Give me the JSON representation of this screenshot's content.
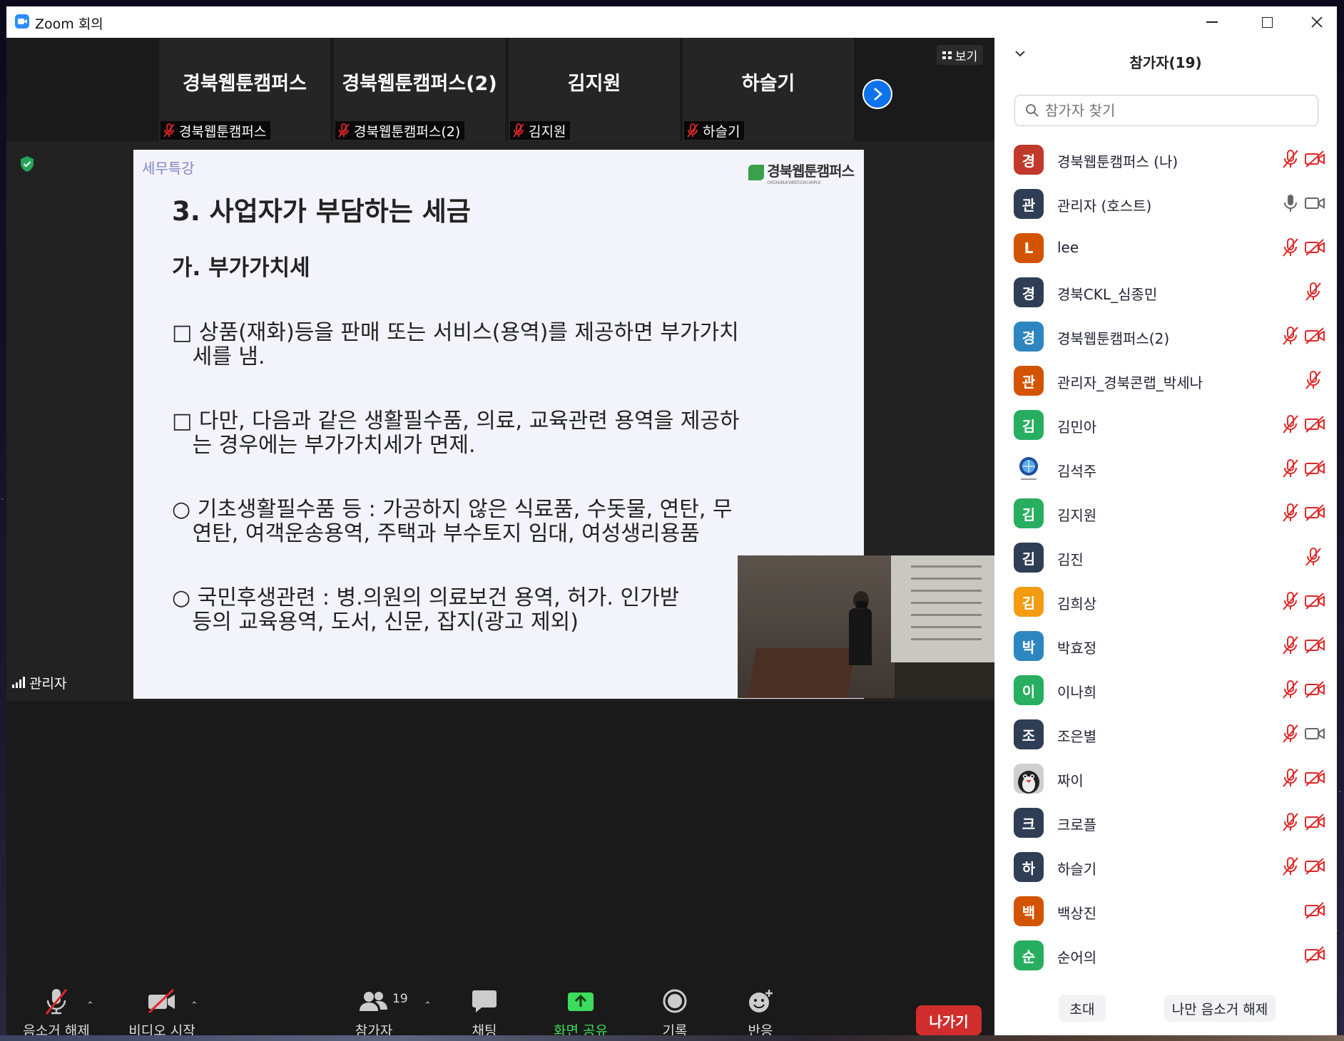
{
  "window": {
    "title": "Zoom 회의"
  },
  "gallery": {
    "tiles": [
      {
        "big_name": "경북웹툰캠퍼스",
        "label": "경북웹툰캠퍼스"
      },
      {
        "big_name": "경북웹툰캠퍼스(2)",
        "label": "경북웹툰캠퍼스(2)"
      },
      {
        "big_name": "김지원",
        "label": "김지원"
      },
      {
        "big_name": "하슬기",
        "label": "하슬기"
      }
    ],
    "view_label": "보기"
  },
  "presenter_label": "관리자",
  "slide": {
    "tag": "세무특강",
    "logo_text": "경북웹툰캠퍼스",
    "logo_subtext": "GYEONGBUK WEBTOON CAMPUS",
    "heading": "3. 사업자가 부담하는 세금",
    "subheading": "가. 부가가치세",
    "paragraphs": [
      "□ 상품(재화)등을 판매 또는 서비스(용역)를 제공하면 부가가치\n   세를 냄.",
      "□ 다만, 다음과 같은 생활필수품, 의료, 교육관련 용역을 제공하\n   는 경우에는 부가가치세가 면제.",
      "○ 기초생활필수품 등 : 가공하지 않은 식료품, 수돗물, 연탄, 무\n   연탄, 여객운송용역, 주택과 부수토지 임대, 여성생리용품",
      "○ 국민후생관련 : 병.의원의 의료보건 용역, 허가. 인가받\n   등의 교육용역, 도서, 신문, 잡지(광고 제외)"
    ]
  },
  "toolbar": {
    "unmute": "음소거 해제",
    "start_video": "비디오 시작",
    "participants": "참가자",
    "participants_count": "19",
    "chat": "채팅",
    "share": "화면 공유",
    "record": "기록",
    "reactions": "반응",
    "leave": "나가기"
  },
  "colors": {
    "accent": "#0E72ED",
    "share_green": "#3ddc5c",
    "leave_red": "#d12d2d",
    "muted_red": "#e02828"
  },
  "panel": {
    "title": "참가자(19)",
    "search_placeholder": "참가자 찾기",
    "participants": [
      {
        "initial": "경",
        "name": "경북웹툰캠퍼스 (나)",
        "color": "#c0392b",
        "mic": "muted",
        "cam": "off"
      },
      {
        "initial": "관",
        "name": "관리자 (호스트)",
        "color": "#2f3e55",
        "mic": "on",
        "cam": "on"
      },
      {
        "initial": "L",
        "name": "lee",
        "color": "#d35400",
        "mic": "muted",
        "cam": "off"
      },
      {
        "initial": "경",
        "name": "경북CKL_심종민",
        "color": "#2f3e55",
        "mic": "muted",
        "cam": "none"
      },
      {
        "initial": "경",
        "name": "경북웹툰캠퍼스(2)",
        "color": "#2e86c1",
        "mic": "muted",
        "cam": "off"
      },
      {
        "initial": "관",
        "name": "관리자_경북콘랩_박세나",
        "color": "#d35400",
        "mic": "muted",
        "cam": "none"
      },
      {
        "initial": "김",
        "name": "김민아",
        "color": "#27ae60",
        "mic": "muted",
        "cam": "off"
      },
      {
        "initial": "",
        "name": "김석주",
        "color": "#ffffff",
        "mic": "muted",
        "cam": "off",
        "photo": "globe"
      },
      {
        "initial": "김",
        "name": "김지원",
        "color": "#27ae60",
        "mic": "muted",
        "cam": "off"
      },
      {
        "initial": "김",
        "name": "김진",
        "color": "#2f3e55",
        "mic": "muted",
        "cam": "none"
      },
      {
        "initial": "김",
        "name": "김희상",
        "color": "#f39c12",
        "mic": "muted",
        "cam": "off"
      },
      {
        "initial": "박",
        "name": "박효정",
        "color": "#2e86c1",
        "mic": "muted",
        "cam": "off"
      },
      {
        "initial": "이",
        "name": "이나희",
        "color": "#27ae60",
        "mic": "muted",
        "cam": "off"
      },
      {
        "initial": "조",
        "name": "조은별",
        "color": "#2f3e55",
        "mic": "muted",
        "cam": "on"
      },
      {
        "initial": "",
        "name": "짜이",
        "color": "#dddddd",
        "mic": "muted",
        "cam": "off",
        "photo": "penguin"
      },
      {
        "initial": "크",
        "name": "크로플",
        "color": "#2f3e55",
        "mic": "muted",
        "cam": "off"
      },
      {
        "initial": "하",
        "name": "하슬기",
        "color": "#2f3e55",
        "mic": "muted",
        "cam": "off"
      },
      {
        "initial": "백",
        "name": "백상진",
        "color": "#d35400",
        "mic": "none",
        "cam": "off"
      },
      {
        "initial": "순",
        "name": "순어의",
        "color": "#27ae60",
        "mic": "none",
        "cam": "off"
      }
    ],
    "invite": "초대",
    "unmute_me": "나만 음소거 해제"
  }
}
